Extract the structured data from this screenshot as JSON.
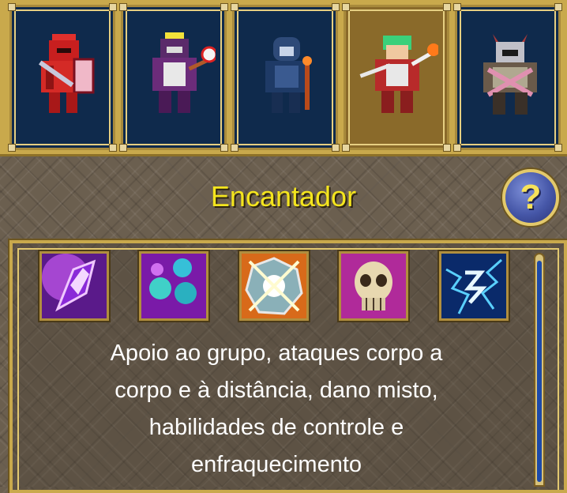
{
  "characters": [
    {
      "name": "red-knight",
      "selected": false
    },
    {
      "name": "purple-mage",
      "selected": false
    },
    {
      "name": "hooded-rogue",
      "selected": false
    },
    {
      "name": "green-haired-enchanter",
      "selected": true
    },
    {
      "name": "horned-warrior",
      "selected": false
    }
  ],
  "class_title": "Encantador",
  "help_label": "?",
  "skills": [
    {
      "name": "purple-crystal-skill-icon"
    },
    {
      "name": "cyan-orbs-skill-icon"
    },
    {
      "name": "light-burst-skill-icon"
    },
    {
      "name": "skull-skill-icon"
    },
    {
      "name": "lightning-rune-skill-icon"
    }
  ],
  "description": {
    "line1": "Apoio ao grupo, ataques corpo a",
    "line2": "corpo e à distância, dano misto,",
    "line3": "habilidades de controle e",
    "line4": "enfraquecimento"
  },
  "colors": {
    "title": "#f4e51e",
    "frame_gold": "#c9a94c",
    "slot_blue": "#0f2a4c",
    "slot_selected": "#8a6a2a"
  }
}
